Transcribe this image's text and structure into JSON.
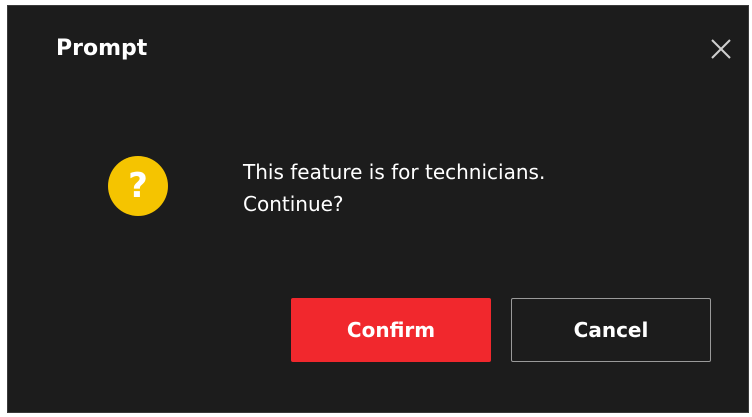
{
  "dialog": {
    "title": "Prompt",
    "close_icon": "close-icon",
    "status_icon": "question-icon",
    "status_glyph": "?",
    "message_line1": "This feature is for technicians.",
    "message_line2": "Continue?",
    "confirm_label": "Confirm",
    "cancel_label": "Cancel"
  },
  "colors": {
    "background": "#1c1c1c",
    "accent": "#f1282d",
    "warning": "#f5c400",
    "text": "#ffffff"
  }
}
